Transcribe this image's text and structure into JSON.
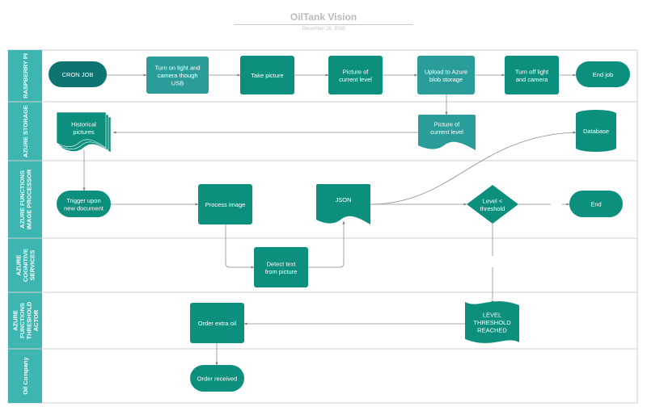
{
  "header": {
    "title": "OilTank Vision",
    "date": "December 28, 2018"
  },
  "colors": {
    "lane_header": "#3eb5b0",
    "node_primary": "#0d8f7d",
    "node_dark": "#0e7472",
    "node_light": "#2a9d9a",
    "edge": "#8e8e8e",
    "grid": "#cfcfcf"
  },
  "lanes": [
    {
      "id": "raspberry",
      "label_lines": [
        "RASPBERRY PI"
      ]
    },
    {
      "id": "storage",
      "label_lines": [
        "AZURE STORAGE"
      ]
    },
    {
      "id": "processor",
      "label_lines": [
        "AZURE FUNCTIONS",
        "IMAGE PROCESSOR"
      ]
    },
    {
      "id": "cognitive",
      "label_lines": [
        "AZURE",
        "COGNITIVE",
        "SERVICES"
      ]
    },
    {
      "id": "actor",
      "label_lines": [
        "AZURE",
        "FUNCTIONS",
        "THRESHOLD",
        "ACTOR"
      ]
    },
    {
      "id": "oil",
      "label_lines": [
        "Oil Company"
      ]
    }
  ],
  "nodes": [
    {
      "id": "cron",
      "shape": "terminator",
      "lines": [
        "CRON JOB"
      ]
    },
    {
      "id": "turnon",
      "shape": "process",
      "lines": [
        "Turn on light and",
        "camera though",
        "USB"
      ]
    },
    {
      "id": "take",
      "shape": "process",
      "lines": [
        "Take picture"
      ]
    },
    {
      "id": "pic1",
      "shape": "process",
      "lines": [
        "Picture of",
        "current level"
      ]
    },
    {
      "id": "upload",
      "shape": "process",
      "lines": [
        "Upload to Azure",
        "blob storage"
      ]
    },
    {
      "id": "turnoff",
      "shape": "process",
      "lines": [
        "Turn off light",
        "and camera"
      ]
    },
    {
      "id": "endjob",
      "shape": "terminator",
      "lines": [
        "End job"
      ]
    },
    {
      "id": "hist",
      "shape": "multidoc",
      "lines": [
        "Historical",
        "pictures"
      ]
    },
    {
      "id": "pic2",
      "shape": "document",
      "lines": [
        "Picture of",
        "current level"
      ]
    },
    {
      "id": "db",
      "shape": "database",
      "lines": [
        "Database"
      ]
    },
    {
      "id": "trigger",
      "shape": "terminator",
      "lines": [
        "Trigger upon",
        "new document"
      ]
    },
    {
      "id": "process",
      "shape": "process",
      "lines": [
        "Process image"
      ]
    },
    {
      "id": "json",
      "shape": "document",
      "lines": [
        "JSON"
      ]
    },
    {
      "id": "decision",
      "shape": "decision",
      "lines": [
        "Level <",
        "threshold"
      ]
    },
    {
      "id": "end",
      "shape": "terminator",
      "lines": [
        "End"
      ]
    },
    {
      "id": "detect",
      "shape": "process",
      "lines": [
        "Detect text",
        "from picture"
      ]
    },
    {
      "id": "level",
      "shape": "tape",
      "lines": [
        "LEVEL",
        "THRESHOLD",
        "REACHED"
      ]
    },
    {
      "id": "order",
      "shape": "process",
      "lines": [
        "Order extra oil"
      ]
    },
    {
      "id": "received",
      "shape": "terminator",
      "lines": [
        "Order received"
      ]
    }
  ],
  "edges": [
    {
      "from": "cron",
      "to": "turnon"
    },
    {
      "from": "turnon",
      "to": "take"
    },
    {
      "from": "take",
      "to": "pic1"
    },
    {
      "from": "pic1",
      "to": "upload"
    },
    {
      "from": "upload",
      "to": "turnoff"
    },
    {
      "from": "turnoff",
      "to": "endjob"
    },
    {
      "from": "upload",
      "to": "pic2"
    },
    {
      "from": "pic2",
      "to": "hist"
    },
    {
      "from": "hist",
      "to": "trigger"
    },
    {
      "from": "trigger",
      "to": "process"
    },
    {
      "from": "process",
      "to": "detect"
    },
    {
      "from": "detect",
      "to": "json"
    },
    {
      "from": "json",
      "to": "db"
    },
    {
      "from": "json",
      "to": "decision"
    },
    {
      "from": "decision",
      "to": "end",
      "style": "dashed"
    },
    {
      "from": "decision",
      "to": "level",
      "style": "dashed"
    },
    {
      "from": "level",
      "to": "order"
    },
    {
      "from": "order",
      "to": "received"
    }
  ]
}
